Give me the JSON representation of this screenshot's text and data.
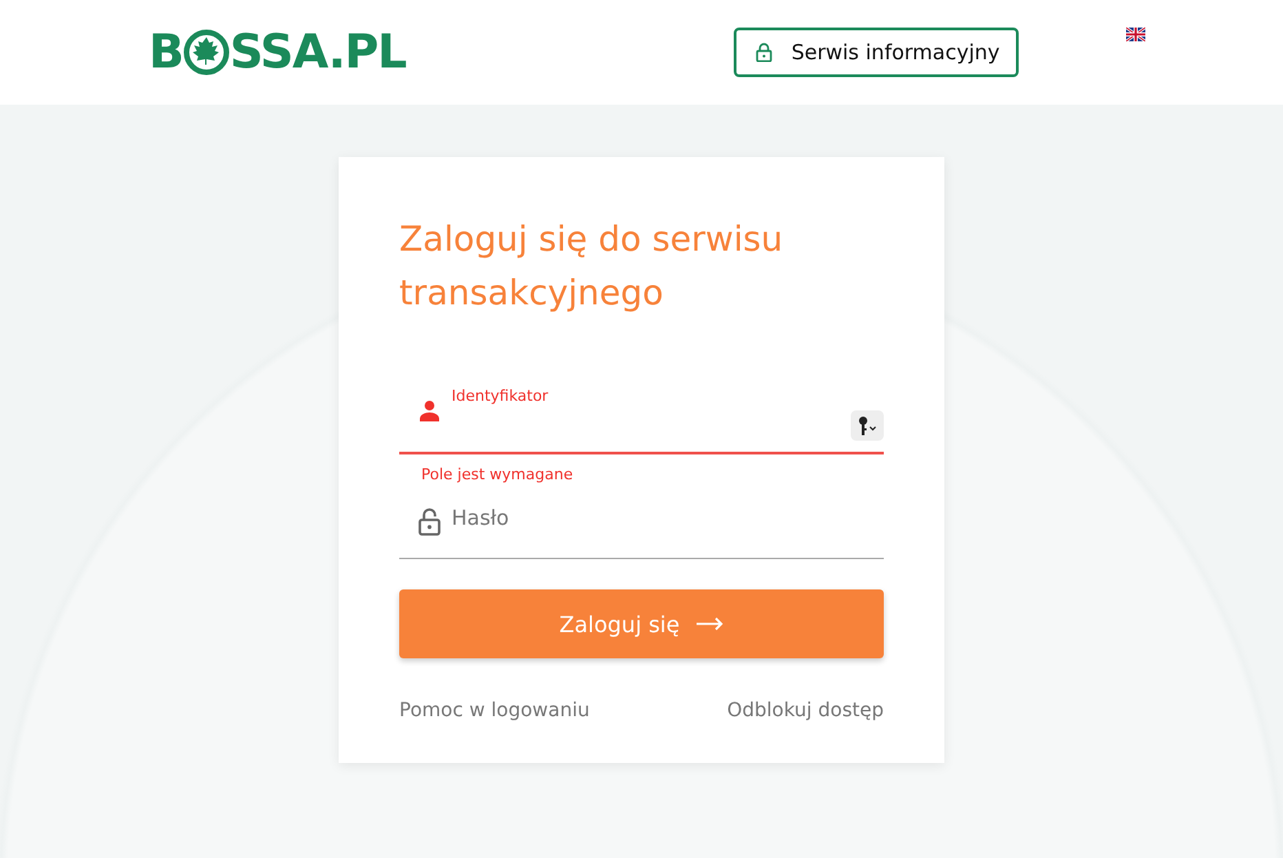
{
  "header": {
    "logo": {
      "before": "B",
      "after": "SSA.PL"
    },
    "info_button": "Serwis informacyjny",
    "language": {
      "selected": true
    }
  },
  "login": {
    "title": "Zaloguj się do serwisu transakcyjnego",
    "fields": [
      {
        "kind": "user",
        "label": "Identyfikator",
        "invalid": true,
        "error": "Pole jest wymagane",
        "key_menu": true
      },
      {
        "kind": "password",
        "placeholder": "Hasło",
        "invalid": false
      }
    ],
    "submit": "Zaloguj się",
    "links": [
      "Pomoc w logowaniu",
      "Odblokuj dostęp"
    ]
  }
}
